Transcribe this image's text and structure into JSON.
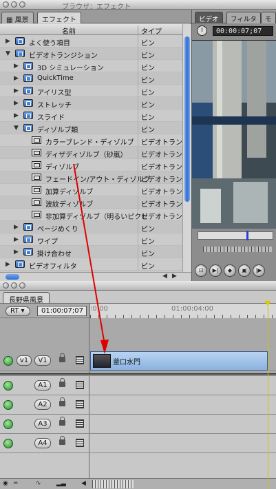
{
  "browser": {
    "title": "ブラウザ：エフェクト",
    "tabs": [
      "風景",
      "エフェクト"
    ],
    "columns": {
      "name": "名前",
      "type": "タイプ"
    },
    "rows": [
      {
        "indent": 0,
        "expand": "closed",
        "icon": "folder",
        "name": "よく使う項目",
        "type": "ビン"
      },
      {
        "indent": 0,
        "expand": "open",
        "icon": "bin",
        "name": "ビデオトランジション",
        "type": "ビン"
      },
      {
        "indent": 1,
        "expand": "closed",
        "icon": "bin",
        "name": "3D シミュレーション",
        "type": "ビン"
      },
      {
        "indent": 1,
        "expand": "closed",
        "icon": "bin",
        "name": "QuickTime",
        "type": "ビン"
      },
      {
        "indent": 1,
        "expand": "closed",
        "icon": "bin",
        "name": "アイリス型",
        "type": "ビン"
      },
      {
        "indent": 1,
        "expand": "closed",
        "icon": "bin",
        "name": "ストレッチ",
        "type": "ビン"
      },
      {
        "indent": 1,
        "expand": "closed",
        "icon": "bin",
        "name": "スライド",
        "type": "ビン"
      },
      {
        "indent": 1,
        "expand": "open",
        "icon": "bin",
        "name": "ディゾルブ類",
        "type": "ビン"
      },
      {
        "indent": 2,
        "expand": "none",
        "icon": "effect",
        "name": "カラーブレンド・ディゾルブ",
        "type": "ビデオトランジ"
      },
      {
        "indent": 2,
        "expand": "none",
        "icon": "effect",
        "name": "ディザディゾルブ（砂嵐）",
        "type": "ビデオトランジ"
      },
      {
        "indent": 2,
        "expand": "none",
        "icon": "effect",
        "name": "ディゾルブ",
        "type": "ビデオトランジ"
      },
      {
        "indent": 2,
        "expand": "none",
        "icon": "effect",
        "name": "フェードイン/アウト・ディゾルブ",
        "type": "ビデオトランジ"
      },
      {
        "indent": 2,
        "expand": "none",
        "icon": "effect",
        "name": "加算ディゾルブ",
        "type": "ビデオトランジ"
      },
      {
        "indent": 2,
        "expand": "none",
        "icon": "effect",
        "name": "波紋ディゾルブ",
        "type": "ビデオトランジ"
      },
      {
        "indent": 2,
        "expand": "none",
        "icon": "effect",
        "name": "非加算ディゾルブ（明るいピクセ",
        "type": "ビデオトランジ"
      },
      {
        "indent": 1,
        "expand": "closed",
        "icon": "bin",
        "name": "ページめくり",
        "type": "ビン"
      },
      {
        "indent": 1,
        "expand": "closed",
        "icon": "bin",
        "name": "ワイプ",
        "type": "ビン"
      },
      {
        "indent": 1,
        "expand": "closed",
        "icon": "bin",
        "name": "掛け合わせ",
        "type": "ビン"
      },
      {
        "indent": 0,
        "expand": "closed",
        "icon": "bin",
        "name": "ビデオフィルタ",
        "type": "ビン"
      }
    ]
  },
  "viewer": {
    "tabs": [
      "ビデオ",
      "フィルタ",
      "モ"
    ],
    "timecode": "00:00:07;07"
  },
  "timeline": {
    "sequence_tab": "長野県風景",
    "rt_label": "RT",
    "timecode": "01:00:07;07",
    "ruler_labels": [
      ":0:00",
      "01:00:04:00"
    ],
    "video_track": {
      "source": "v1",
      "dest": "V1"
    },
    "clip_name": "釜口水門",
    "audio_tracks": [
      "A1",
      "A2",
      "A3",
      "A4"
    ]
  },
  "colors": {
    "selection_blue": "#2e6fd1",
    "clip_blue": "#a8c8ec",
    "arrow_red": "#e00000"
  }
}
